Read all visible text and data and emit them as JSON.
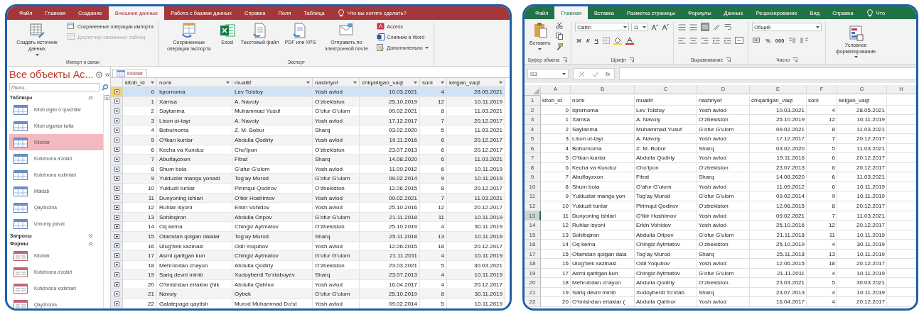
{
  "access": {
    "tabs": [
      {
        "label": "Файл",
        "selected": false
      },
      {
        "label": "Главная",
        "selected": false
      },
      {
        "label": "Создание",
        "selected": false
      },
      {
        "label": "Внешние данные",
        "selected": true
      },
      {
        "label": "Работа с базами данных",
        "selected": false
      },
      {
        "label": "Справка",
        "selected": false
      },
      {
        "label": "Поля",
        "selected": false
      },
      {
        "label": "Таблица",
        "selected": false
      }
    ],
    "tell_me": "Что вы хотите сделать?",
    "ribbon_groups": [
      {
        "label": "Импорт и связи",
        "commands": [
          {
            "label": "Создать источник данных",
            "kind": "large",
            "dropdown": true,
            "disabled": false
          },
          {
            "label": "Сохраненные операции импорта",
            "kind": "small",
            "dropdown": false,
            "disabled": false
          },
          {
            "label": "Диспетчер связанных таблиц",
            "kind": "small",
            "dropdown": false,
            "disabled": true
          }
        ]
      },
      {
        "label": "Экспорт",
        "commands": [
          {
            "label": "Сохраненные операции экспорта",
            "kind": "large",
            "dropdown": false,
            "disabled": false
          },
          {
            "label": "Excel",
            "kind": "large",
            "dropdown": false,
            "disabled": false
          },
          {
            "label": "Текстовый файл",
            "kind": "large",
            "dropdown": false,
            "disabled": false
          },
          {
            "label": "PDF или XPS",
            "kind": "large",
            "dropdown": false,
            "disabled": false
          },
          {
            "label": "Отправить по электронной почте",
            "kind": "large",
            "dropdown": false,
            "disabled": false
          },
          {
            "label": "Access",
            "kind": "small",
            "dropdown": false,
            "disabled": false
          },
          {
            "label": "Слияние в Word",
            "kind": "small",
            "dropdown": false,
            "disabled": false
          },
          {
            "label": "Дополнительно",
            "kind": "small",
            "dropdown": true,
            "disabled": false
          }
        ]
      }
    ],
    "nav_pane": {
      "title": "Все объекты Ac...",
      "search_placeholder": "Поиск...",
      "sections": [
        {
          "label": "Таблицы",
          "kind": "table",
          "expanded": true,
          "items": [
            {
              "label": "Kitob olgan o`quvchilar",
              "selected": false
            },
            {
              "label": "Kitob olganlar katta",
              "selected": false
            },
            {
              "label": "Kitoblar",
              "selected": true
            },
            {
              "label": "Kutubxona a'zolari",
              "selected": false
            },
            {
              "label": "Kutubxona xodimlari",
              "selected": false
            },
            {
              "label": "Maktab",
              "selected": false
            },
            {
              "label": "Qaydnoma",
              "selected": false
            },
            {
              "label": "Umumiy jadval",
              "selected": false
            }
          ]
        },
        {
          "label": "Запросы",
          "kind": "query",
          "expanded": false
        },
        {
          "label": "Формы",
          "kind": "form",
          "expanded": true,
          "items": [
            {
              "label": "Kitoblar",
              "selected": false
            },
            {
              "label": "Kutubxona a'zolari",
              "selected": false
            },
            {
              "label": "Kutubxona xodimlari",
              "selected": false
            },
            {
              "label": "Qaydnoma",
              "selected": false
            }
          ]
        }
      ]
    },
    "document_tab": "Kitoblar",
    "table": {
      "columns": [
        {
          "label": "kitob_id",
          "kind": "number"
        },
        {
          "label": "nomi",
          "kind": "text"
        },
        {
          "label": "muallif",
          "kind": "text"
        },
        {
          "label": "nashriyot",
          "kind": "text"
        },
        {
          "label": "chiqarilgan_vaqt",
          "kind": "date"
        },
        {
          "label": "soni",
          "kind": "number"
        },
        {
          "label": "kelgan_vaqt",
          "kind": "date"
        }
      ],
      "rows": [
        {
          "selected": true,
          "cells": [
            "0",
            "Iqrornoma",
            "Lev Tolstoy",
            "Yosh avlod",
            "10.03.2021",
            "4",
            "28.05.2021"
          ]
        },
        {
          "selected": false,
          "cells": [
            "1",
            "Xamsa",
            "A. Navoiy",
            "O’zbekiston",
            "25.10.2019",
            "12",
            "10.11.2019"
          ]
        },
        {
          "selected": false,
          "cells": [
            "2",
            "Saylanma",
            "Muhammad Yusuf",
            "G’ofur G’ulom",
            "09.02.2021",
            "8",
            "11.03.2021"
          ]
        },
        {
          "selected": false,
          "cells": [
            "3",
            "Lison ut-tayr",
            "A. Navoiy",
            "Yosh avlod",
            "17.12.2017",
            "7",
            "20.12.2017"
          ]
        },
        {
          "selected": false,
          "cells": [
            "4",
            "Boburnoma",
            "Z. M. Bobur",
            "Sharq",
            "03.02.2020",
            "5",
            "11.03.2021"
          ]
        },
        {
          "selected": false,
          "cells": [
            "5",
            "O’tkan kunlar",
            "Abdulla Qodiriy",
            "Yosh avlod",
            "19.11.2016",
            "6",
            "20.12.2017"
          ]
        },
        {
          "selected": false,
          "cells": [
            "6",
            "Kecha va Kunduz",
            "Cho’lpon",
            "O’zbekiston",
            "23.07.2013",
            "6",
            "20.12.2017"
          ]
        },
        {
          "selected": false,
          "cells": [
            "7",
            "Abulfayzxon",
            "Fitrat",
            "Sharq",
            "14.08.2020",
            "6",
            "11.03.2021"
          ]
        },
        {
          "selected": false,
          "cells": [
            "8",
            "Shum bola",
            "G’afur G’ulom",
            "Yosh avlod",
            "11.09.2012",
            "6",
            "10.11.2019"
          ]
        },
        {
          "selected": false,
          "cells": [
            "9",
            "Yulduzlar mangu yonadi",
            "Tog’ay Murod",
            "G’ofur G’ulom",
            "09.02.2014",
            "9",
            "10.11.2019"
          ]
        },
        {
          "selected": false,
          "cells": [
            "10",
            "Yulduzli tunlar",
            "Pirimqul Qodirov",
            "O’zbekiston",
            "12.06.2015",
            "8",
            "20.12.2017"
          ]
        },
        {
          "selected": false,
          "cells": [
            "11",
            "Dunyoning ishlari",
            "O’tkir Hoshimov",
            "Yosh avlod",
            "09.02.2021",
            "7",
            "11.03.2021"
          ]
        },
        {
          "selected": false,
          "cells": [
            "12",
            "Ruhlar isyoni",
            "Erkin Vohidov",
            "Yosh avlod",
            "25.10.2016",
            "12",
            "20.12.2017"
          ]
        },
        {
          "selected": false,
          "cells": [
            "13",
            "Sohibqiron",
            "Abdulla Oripov",
            "G’ofur G’ulom",
            "21.11.2018",
            "11",
            "10.11.2019"
          ]
        },
        {
          "selected": false,
          "cells": [
            "14",
            "Oq kema",
            "Chingiz Aytmatov",
            "O’zbekiston",
            "25.10.2019",
            "4",
            "30.11.2019"
          ]
        },
        {
          "selected": false,
          "cells": [
            "15",
            "Otamdan qolgan dalalar",
            "Tog’ay Murod",
            "Sharq",
            "25.11.2018",
            "13",
            "10.11.2019"
          ]
        },
        {
          "selected": false,
          "cells": [
            "16",
            "Ulug’bek xazinasi",
            "Odil Yoqubov",
            "Yosh avlod",
            "12.06.2015",
            "18",
            "20.12.2017"
          ]
        },
        {
          "selected": false,
          "cells": [
            "17",
            "Asrni qaritgan kun",
            "Chingiz Aytmatov",
            "G’ofur G’ulom",
            "21.11.2011",
            "4",
            "10.11.2019"
          ]
        },
        {
          "selected": false,
          "cells": [
            "18",
            "Mehrobdan chayon",
            "Abdulla Qodiriy",
            "O’zbekiston",
            "23.03.2021",
            "5",
            "30.03.2021"
          ]
        },
        {
          "selected": false,
          "cells": [
            "19",
            "Sariq devni minib",
            "Xudoyberdi To’xtaboyev",
            "Sharq",
            "23.07.2013",
            "4",
            "10.11.2019"
          ]
        },
        {
          "selected": false,
          "cells": [
            "20",
            "O’tmishdan ertaklar (hik",
            "Abdulla Qahhor",
            "Yosh avlod",
            "16.04.2017",
            "4",
            "20.12.2017"
          ]
        },
        {
          "selected": false,
          "cells": [
            "21",
            "Navoiy",
            "Oybek",
            "G’ofur G’ulom",
            "25.10.2019",
            "8",
            "30.11.2019"
          ]
        },
        {
          "selected": false,
          "cells": [
            "22",
            "Galatepaga qaytish",
            "Murod Muhammad Do’st",
            "Yosh avlod",
            "09.02.2014",
            "5",
            "10.11.2019"
          ]
        }
      ]
    }
  },
  "excel": {
    "tabs": [
      {
        "label": "Файл",
        "selected": false
      },
      {
        "label": "Главная",
        "selected": true
      },
      {
        "label": "Вставка",
        "selected": false
      },
      {
        "label": "Разметка страницы",
        "selected": false
      },
      {
        "label": "Формулы",
        "selected": false
      },
      {
        "label": "Данные",
        "selected": false
      },
      {
        "label": "Рецензирование",
        "selected": false
      },
      {
        "label": "Вид",
        "selected": false
      },
      {
        "label": "Справка",
        "selected": false
      }
    ],
    "tell_me": "Что",
    "ribbon": {
      "clipboard": {
        "paste_label": "Вставить",
        "label": "Буфер обмена"
      },
      "font": {
        "name": "Calibri",
        "size": "11",
        "styles": [
          "Ж",
          "К",
          "Ч"
        ],
        "label": "Шрифт"
      },
      "alignment": {
        "label": "Выравнивание"
      },
      "number": {
        "format": "Общий",
        "symbols": [
          "%",
          "000"
        ],
        "label": "Число"
      },
      "styles": {
        "conditional_label": "Условное форматирование"
      }
    },
    "formula_bar": {
      "name_box": "I13",
      "function_label": "fx"
    },
    "sheet": {
      "columns": [
        {
          "letter": "A",
          "kind": "number"
        },
        {
          "letter": "B",
          "kind": "text"
        },
        {
          "letter": "C",
          "kind": "text"
        },
        {
          "letter": "D",
          "kind": "text"
        },
        {
          "letter": "E",
          "kind": "date"
        },
        {
          "letter": "F",
          "kind": "number"
        },
        {
          "letter": "G",
          "kind": "date"
        },
        {
          "letter": "H",
          "kind": "text"
        }
      ],
      "rows": [
        {
          "number": "1",
          "kind": "header",
          "selected": false,
          "cells": [
            "kitob_id",
            "nomi",
            "muallif",
            "nashriyot",
            "chiqarilgan_vaqt",
            "soni",
            "kelgan_vaqt"
          ]
        },
        {
          "number": "2",
          "kind": "data",
          "selected": false,
          "cells": [
            "0",
            "Iqrornoma",
            "Lev Tolstoy",
            "Yosh avlod",
            "10.03.2021",
            "4",
            "28.05.2021"
          ]
        },
        {
          "number": "3",
          "kind": "data",
          "selected": false,
          "cells": [
            "1",
            "Xamsa",
            "A. Navoiy",
            "O’zbekiston",
            "25.10.2019",
            "12",
            "10.11.2019"
          ]
        },
        {
          "number": "4",
          "kind": "data",
          "selected": false,
          "cells": [
            "2",
            "Saylanma",
            "Muhammad Yusuf",
            "G’ofur G’ulom",
            "09.02.2021",
            "8",
            "11.03.2021"
          ]
        },
        {
          "number": "5",
          "kind": "data",
          "selected": false,
          "cells": [
            "3",
            "Lison ut-tayr",
            "A. Navoiy",
            "Yosh avlod",
            "17.12.2017",
            "7",
            "20.12.2017"
          ]
        },
        {
          "number": "6",
          "kind": "data",
          "selected": false,
          "cells": [
            "4",
            "Boburnoma",
            "Z. M. Bobur",
            "Sharq",
            "03.02.2020",
            "5",
            "11.03.2021"
          ]
        },
        {
          "number": "7",
          "kind": "data",
          "selected": false,
          "cells": [
            "5",
            "O’tkan kunlar",
            "Abdulla Qodiriy",
            "Yosh avlod",
            "19.11.2016",
            "6",
            "20.12.2017"
          ]
        },
        {
          "number": "8",
          "kind": "data",
          "selected": false,
          "cells": [
            "6",
            "Kecha va Kunduz",
            "Cho’lpon",
            "O’zbekiston",
            "23.07.2013",
            "6",
            "20.12.2017"
          ]
        },
        {
          "number": "9",
          "kind": "data",
          "selected": false,
          "cells": [
            "7",
            "Abulfayzxon",
            "Fitrat",
            "Sharq",
            "14.08.2020",
            "6",
            "11.03.2021"
          ]
        },
        {
          "number": "10",
          "kind": "data",
          "selected": false,
          "cells": [
            "8",
            "Shum bola",
            "G’afur G’ulom",
            "Yosh avlod",
            "11.09.2012",
            "6",
            "10.11.2019"
          ]
        },
        {
          "number": "11",
          "kind": "data",
          "selected": false,
          "cells": [
            "9",
            "Yulduzlar mangu yon",
            "Tog’ay Murod",
            "G’ofur G’ulom",
            "09.02.2014",
            "9",
            "10.11.2019"
          ]
        },
        {
          "number": "12",
          "kind": "data",
          "selected": false,
          "cells": [
            "10",
            "Yulduzli tunlar",
            "Pirimqul Qodirov",
            "O’zbekiston",
            "12.06.2015",
            "8",
            "20.12.2017"
          ]
        },
        {
          "number": "13",
          "kind": "data",
          "selected": true,
          "cells": [
            "11",
            "Dunyoning ishlari",
            "O’tkir Hoshimov",
            "Yosh avlod",
            "09.02.2021",
            "7",
            "11.03.2021"
          ]
        },
        {
          "number": "14",
          "kind": "data",
          "selected": false,
          "cells": [
            "12",
            "Ruhlar isyoni",
            "Erkin Vohidov",
            "Yosh avlod",
            "25.10.2016",
            "12",
            "20.12.2017"
          ]
        },
        {
          "number": "15",
          "kind": "data",
          "selected": false,
          "cells": [
            "13",
            "Sohibqiron",
            "Abdulla Oripov",
            "G’ofur G’ulom",
            "21.11.2018",
            "11",
            "10.11.2019"
          ]
        },
        {
          "number": "16",
          "kind": "data",
          "selected": false,
          "cells": [
            "14",
            "Oq kema",
            "Chingiz Aytmatov",
            "O’zbekiston",
            "25.10.2019",
            "4",
            "30.11.2019"
          ]
        },
        {
          "number": "17",
          "kind": "data",
          "selected": false,
          "cells": [
            "15",
            "Otamdan qolgan dala",
            "Tog’ay Murod",
            "Sharq",
            "25.11.2018",
            "13",
            "10.11.2019"
          ]
        },
        {
          "number": "18",
          "kind": "data",
          "selected": false,
          "cells": [
            "16",
            "Ulug’bek xazinasi",
            "Odil Yoqubov",
            "Yosh avlod",
            "12.06.2015",
            "18",
            "20.12.2017"
          ]
        },
        {
          "number": "19",
          "kind": "data",
          "selected": false,
          "cells": [
            "17",
            "Asrni qaritgan kun",
            "Chingiz Aytmatov",
            "G’ofur G’ulom",
            "21.11.2011",
            "4",
            "10.11.2019"
          ]
        },
        {
          "number": "20",
          "kind": "data",
          "selected": false,
          "cells": [
            "18",
            "Mehrobdan chayon",
            "Abdulla Qodiriy",
            "O’zbekiston",
            "23.03.2021",
            "5",
            "30.03.2021"
          ]
        },
        {
          "number": "21",
          "kind": "data",
          "selected": false,
          "cells": [
            "19",
            "Sariq devni minib",
            "Xudoyberdi To’xtab",
            "Sharq",
            "23.07.2013",
            "4",
            "10.11.2019"
          ]
        },
        {
          "number": "22",
          "kind": "data",
          "selected": false,
          "cells": [
            "20",
            "O’tmishdan ertaklar (",
            "Abdulla Qahhor",
            "Yosh avlod",
            "16.04.2017",
            "4",
            "20.12.2017"
          ]
        }
      ]
    }
  }
}
